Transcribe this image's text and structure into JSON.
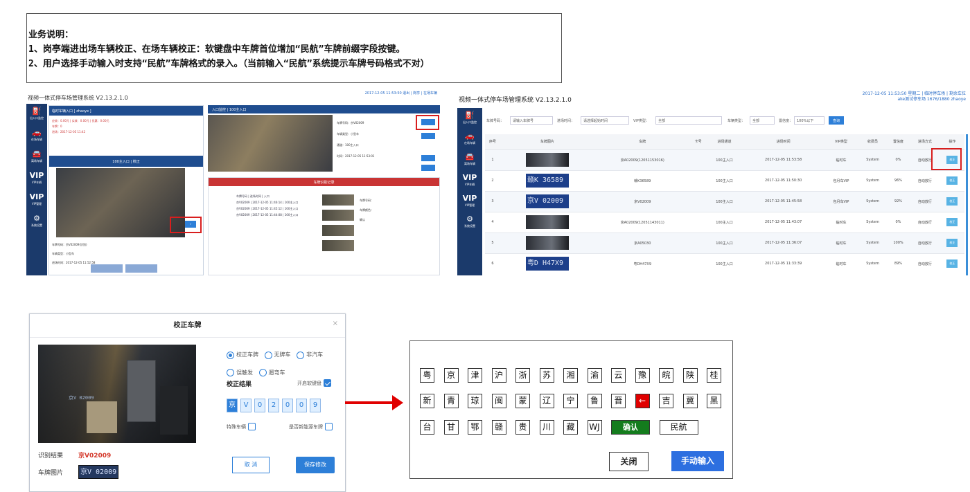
{
  "note": {
    "title": "业务说明：",
    "line1": "1、岗亭端进出场车辆校正、在场车辆校正：软键盘中车牌首位增加“民航”车牌前缀字段按键。",
    "line2": "2、用户选择手动输入时支持“民航”车牌格式的录入。（当前输入“民航”系统提示车牌号码格式不对）"
  },
  "shot1": {
    "title": "视频一体式停车场管理系统 V2.13.2.1.0",
    "header_right": "2017-12-05 11:53:50 退出 | 岗亭 | 在场车辆",
    "sidebar": [
      "出入口监控",
      "在场车辆",
      "离场车辆",
      "VIP车辆",
      "VIP管理",
      "系统设置"
    ],
    "left_top": "临时车辆入口 [ zhaoye ]",
    "left_lines": [
      "应收：0.00元 | 实收：0.00元 | 优惠：0.00元",
      "车牌：0",
      "进场：2017-12-05 11:42"
    ],
    "cam_header": "100主入口 | 校正",
    "left_info": [
      "车牌号码：京V02009(识别)",
      "车辆类型：小型车",
      "进场时间：2017-12-05 11:52:58"
    ],
    "right_top": "入口监控 | 100主入口",
    "right_info": [
      "车牌号码：京V02009",
      "车辆类型：小型车",
      "通道：100主入口",
      "时间：2017-12-05 11:53:01"
    ],
    "lower_header": "车牌识别记录",
    "list": [
      "车牌号码 | 进场时间 | 入口",
      "京V02009 | 2017-12-05 11:46:14 | 100主入口",
      "京V02009 | 2017-12-05 11:45:12 | 100主入口",
      "京V02009 | 2017-12-05 11:44:08 | 100主入口"
    ],
    "form": [
      "车牌号码：",
      "车牌颜色：",
      "确认"
    ]
  },
  "shot2": {
    "title": "视频一体式停车场管理系统 V2.13.2.1.0",
    "header_right_1": "2017-12-05 11:53:50 星期二 | 临时停车场 | 剩余车位",
    "header_right_2": "ake测试停车场  1676/1880  zhaoye",
    "sidebar": [
      "出入口监控",
      "在场车辆",
      "离场车辆",
      "VIP车辆",
      "VIP管理",
      "系统设置"
    ],
    "filters": {
      "plate_label": "车牌号码：",
      "plate_placeholder": "请输入车牌号",
      "time_label": "进场时间：",
      "time_placeholder": "请选择起始时间",
      "vip_label": "VIP类型：",
      "vip_value": "全部",
      "type_label": "车辆类型：",
      "type_value": "全部",
      "conf_label": "置信度：",
      "conf_value": "100%以下",
      "search": "查询"
    },
    "columns": [
      "序号",
      "车牌图片",
      "车牌",
      "卡号",
      "进场通道",
      "进场时间",
      "VIP类型",
      "收费员",
      "置信度",
      "进场方式",
      "操作"
    ],
    "rows": [
      {
        "no": "1",
        "img": "",
        "plate": "京A02009(12051153016)",
        "card": "",
        "channel": "100主入口",
        "time": "2017-12-05 11:53:58",
        "vip": "临时车",
        "op": "System",
        "conf": "0%",
        "mode": "自动放行",
        "action": "校正"
      },
      {
        "no": "2",
        "img": "赣K 36589",
        "plate": "赣K36589",
        "card": "",
        "channel": "100主入口",
        "time": "2017-12-05 11:50:30",
        "vip": "包月车VIP",
        "op": "System",
        "conf": "96%",
        "mode": "自动放行",
        "action": "校正"
      },
      {
        "no": "3",
        "img": "京V 02009",
        "plate": "京V02009",
        "card": "",
        "channel": "100主入口",
        "time": "2017-12-05 11:45:58",
        "vip": "包月车VIP",
        "op": "System",
        "conf": "92%",
        "mode": "自动放行",
        "action": "校正"
      },
      {
        "no": "4",
        "img": "",
        "plate": "京A02009(12051143011)",
        "card": "",
        "channel": "100主入口",
        "time": "2017-12-05 11:43:07",
        "vip": "临时车",
        "op": "System",
        "conf": "0%",
        "mode": "自动放行",
        "action": "校正"
      },
      {
        "no": "5",
        "img": "",
        "plate": "京A05030",
        "card": "",
        "channel": "100主入口",
        "time": "2017-12-05 11:36:07",
        "vip": "临时车",
        "op": "System",
        "conf": "100%",
        "mode": "自动放行",
        "action": "校正"
      },
      {
        "no": "6",
        "img": "粤D H47X9",
        "plate": "粤DH47X9",
        "card": "",
        "channel": "100主入口",
        "time": "2017-12-05 11:33:39",
        "vip": "临时车",
        "op": "System",
        "conf": "89%",
        "mode": "自动放行",
        "action": "校正"
      }
    ]
  },
  "dialog": {
    "title": "校正车牌",
    "close": "×",
    "photo_plate": "京V 02009",
    "radios": [
      {
        "label": "校正车牌",
        "selected": true
      },
      {
        "label": "无牌车",
        "selected": false
      },
      {
        "label": "非汽车",
        "selected": false
      },
      {
        "label": "误触发",
        "selected": false
      },
      {
        "label": "遛弯车",
        "selected": false
      }
    ],
    "section": "校正结果",
    "vk_label": "开启软键盘",
    "chars": [
      "京",
      "V",
      "0",
      "2",
      "0",
      "0",
      "9"
    ],
    "opt1": "特殊车辆",
    "opt2": "是否新能源车牌",
    "result_label": "识别结果",
    "result_value": "京V02009",
    "plate_label": "车牌图片",
    "plate_img": "京V 02009",
    "cancel": "取 消",
    "save": "保存修改"
  },
  "keyboard": {
    "row1": [
      "粤",
      "京",
      "津",
      "沪",
      "浙",
      "苏",
      "湘",
      "渝",
      "云",
      "豫",
      "皖",
      "陕",
      "桂"
    ],
    "row2": [
      "新",
      "青",
      "琼",
      "闽",
      "蒙",
      "辽",
      "宁",
      "鲁",
      "晋",
      "←",
      "吉",
      "冀",
      "黑"
    ],
    "row3": [
      "台",
      "甘",
      "鄂",
      "赣",
      "贵",
      "川",
      "藏",
      "WJ"
    ],
    "confirm": "确认",
    "civil": "民航",
    "close": "关闭",
    "manual": "手动输入"
  },
  "colors": {
    "accent": "#2d7fd8",
    "sidebar": "#1b3a6b",
    "highlight_red": "#d81e1e",
    "confirm_green": "#147c1d"
  }
}
